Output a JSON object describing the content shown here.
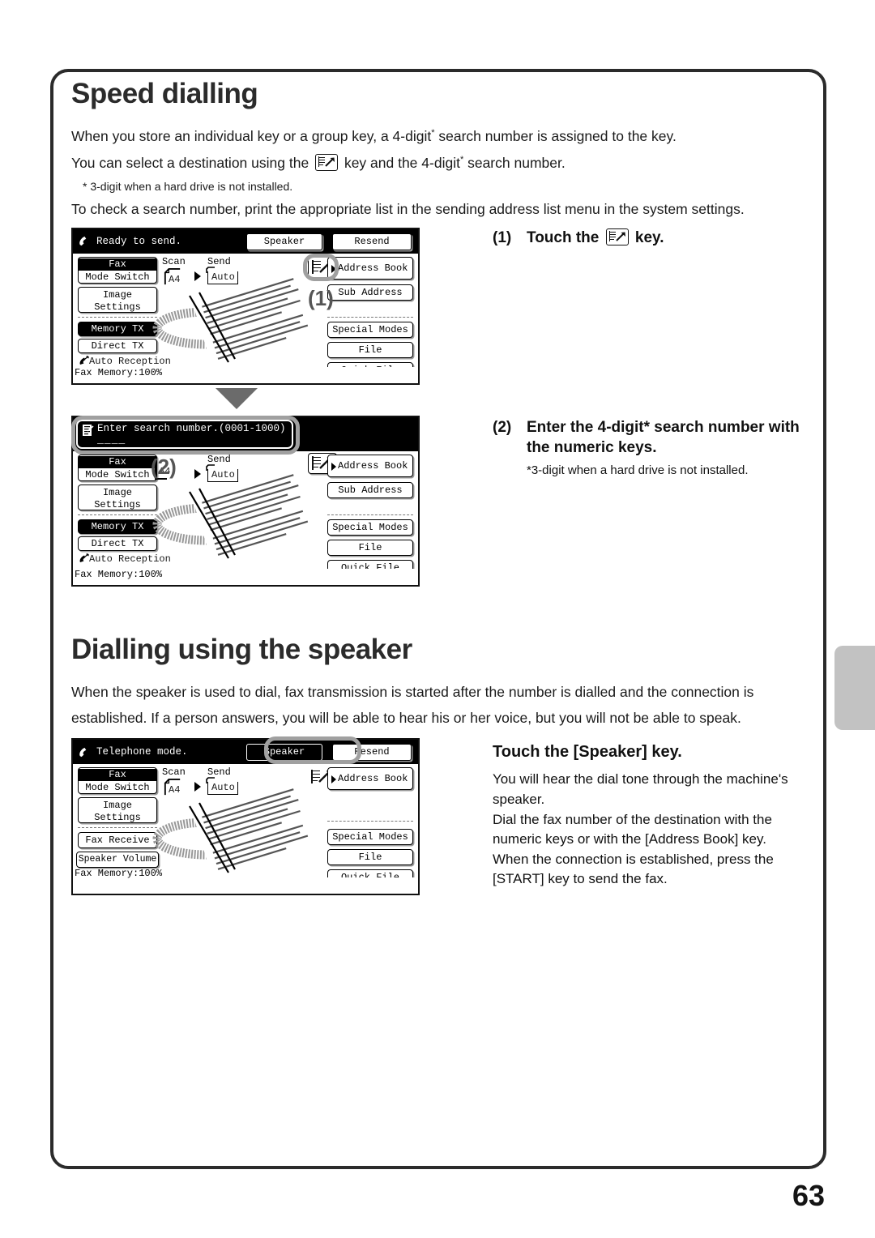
{
  "page": {
    "number": "63"
  },
  "section1": {
    "title": "Speed dialling",
    "para1": "When you store an individual key or a group key, a 4-digit",
    "para1_tail": " search number is assigned to the key.",
    "para2_pre": "You can select a destination using the",
    "para2_mid": "key and the 4-digit",
    "para2_tail": " search number.",
    "footnote": "* 3-digit when a hard drive is not installed.",
    "para3": "To check a search number, print the appropriate list in the sending address list menu in the system settings."
  },
  "steps": [
    {
      "num": "(1)",
      "text_pre": "Touch the",
      "text_post": "key."
    },
    {
      "num": "(2)",
      "text": "Enter the 4-digit* search number with the numeric keys.",
      "note": "*3-digit when a hard drive is not installed."
    }
  ],
  "section2": {
    "title": "Dialling using the speaker",
    "para1": "When the speaker is used to dial, fax transmission is started after the number is dialled and the connection is",
    "para2": "established. If a person answers, you will be able to hear his or her voice, but you will not be able to speak.",
    "instruction_title": "Touch the [Speaker] key.",
    "instruction_lines": [
      "You will hear the dial tone through the machine's",
      "speaker.",
      "Dial the fax number of the destination with the",
      "numeric keys or with the [Address Book] key.",
      "When the connection is established, press the",
      "[START] key to send the fax."
    ]
  },
  "lcd1": {
    "status": "Ready to send.",
    "header_buttons": [
      "Speaker",
      "Resend"
    ],
    "mode_switch_top": "Fax",
    "mode_switch_bottom": "Mode Switch",
    "image_settings": "Image\nSettings",
    "image_settings_l1": "Image",
    "image_settings_l2": "Settings",
    "memory_tx": "Memory TX",
    "direct_tx": "Direct TX",
    "auto_reception": "Auto Reception",
    "fax_memory": "Fax Memory:100%",
    "scan_label": "Scan",
    "send_label": "Send",
    "paper_size": "A4",
    "auto_label": "Auto",
    "right_buttons": [
      "Address Book",
      "Sub Address",
      "Special Modes",
      "File",
      "Quick File"
    ],
    "callout": "(1)"
  },
  "lcd2": {
    "entry_prompt": "Enter search number.(0001-1000)",
    "entry_value": "____",
    "mode_switch_top": "Fax",
    "mode_switch_bottom": "Mode Switch",
    "image_settings_l1": "Image",
    "image_settings_l2": "Settings",
    "memory_tx": "Memory TX",
    "direct_tx": "Direct TX",
    "auto_reception": "Auto Reception",
    "fax_memory": "Fax Memory:100%",
    "send_label": "Send",
    "paper_size": "A4",
    "auto_label": "Auto",
    "right_buttons": [
      "Address Book",
      "Sub Address",
      "Special Modes",
      "File",
      "Quick File"
    ],
    "callout": "(2)"
  },
  "lcd3": {
    "status": "Telephone mode.",
    "header_buttons": [
      "Speaker",
      "Resend"
    ],
    "mode_switch_top": "Fax",
    "mode_switch_bottom": "Mode Switch",
    "image_settings_l1": "Image",
    "image_settings_l2": "Settings",
    "fax_receive": "Fax Receive",
    "speaker_volume": "Speaker Volume",
    "fax_memory": "Fax Memory:100%",
    "scan_label": "Scan",
    "send_label": "Send",
    "paper_size": "A4",
    "auto_label": "Auto",
    "right_buttons": [
      "Address Book",
      "Special Modes",
      "File",
      "Quick File"
    ]
  },
  "colors": {
    "frame": "#2b2b2b",
    "tab": "#c2c2c2",
    "highlight_ring": "#a0a0a0"
  }
}
